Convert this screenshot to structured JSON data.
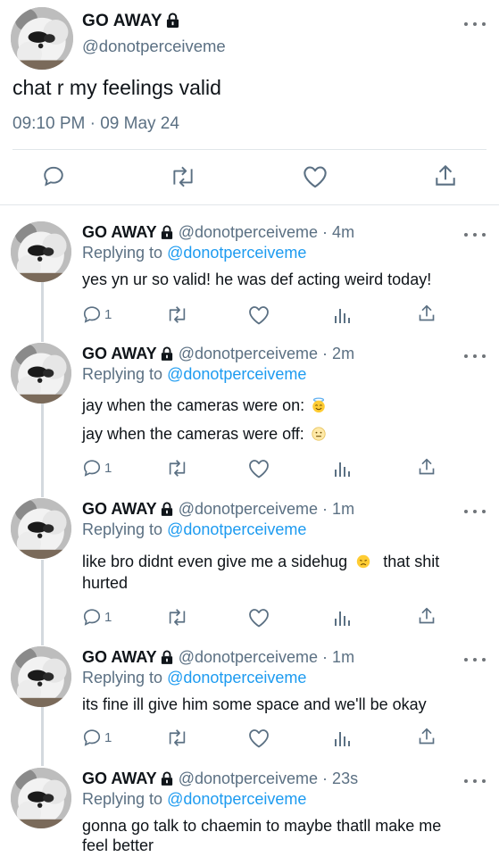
{
  "main": {
    "name": "GO AWAY",
    "handle": "@donotperceiveme",
    "text": "chat r my feelings valid",
    "timestamp": "09:10 PM · 09 May 24"
  },
  "replies": [
    {
      "name": "GO AWAY",
      "meta": "@donotperceiveme · 4m",
      "replying_prefix": "Replying to",
      "replying_to": "@donotperceiveme",
      "lines": [
        "yes yn ur so valid! he was def acting weird today!"
      ],
      "reply_count": "1"
    },
    {
      "name": "GO AWAY",
      "meta": "@donotperceiveme · 2m",
      "replying_prefix": "Replying to",
      "replying_to": "@donotperceiveme",
      "lines": [
        "jay when the cameras were on:",
        "jay when the cameras were off:"
      ],
      "emojis": [
        "smiling-face-with-halo",
        "neutral-face"
      ],
      "reply_count": "1"
    },
    {
      "name": "GO AWAY",
      "meta": "@donotperceiveme · 1m",
      "replying_prefix": "Replying to",
      "replying_to": "@donotperceiveme",
      "lines": [
        "like bro didnt even give me a sidehug",
        "that shit",
        "hurted"
      ],
      "emojis": [
        "disappointed-face"
      ],
      "reply_count": "1"
    },
    {
      "name": "GO AWAY",
      "meta": "@donotperceiveme · 1m",
      "replying_prefix": "Replying to",
      "replying_to": "@donotperceiveme",
      "lines": [
        "its fine ill give him some space and we'll be okay"
      ],
      "reply_count": "1"
    },
    {
      "name": "GO AWAY",
      "meta": "@donotperceiveme · 23s",
      "replying_prefix": "Replying to",
      "replying_to": "@donotperceiveme",
      "lines": [
        "gonna go talk to chaemin to maybe thatll make me",
        "feel better"
      ]
    }
  ],
  "icons": [
    "lock-icon",
    "more-icon",
    "reply-icon",
    "retweet-icon",
    "like-icon",
    "analytics-icon",
    "share-icon"
  ],
  "colors": {
    "accent": "#1d9bf0",
    "muted": "#5b7083",
    "text": "#0f1419",
    "divider": "#e1e6ea"
  }
}
